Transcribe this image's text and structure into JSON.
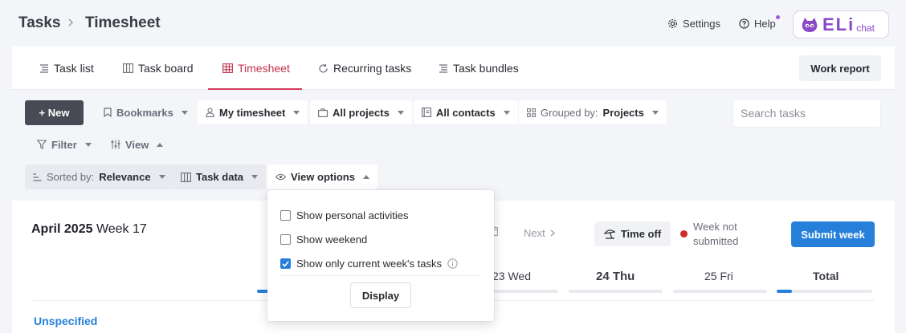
{
  "breadcrumb": {
    "parent": "Tasks",
    "current": "Timesheet"
  },
  "top_links": {
    "settings": "Settings",
    "help": "Help"
  },
  "eli": {
    "logo": "ELi",
    "sub": "chat"
  },
  "tabs": [
    {
      "label": "Task list",
      "icon": "list-icon"
    },
    {
      "label": "Task board",
      "icon": "board-icon"
    },
    {
      "label": "Timesheet",
      "icon": "grid-icon",
      "active": true
    },
    {
      "label": "Recurring tasks",
      "icon": "refresh-icon"
    },
    {
      "label": "Task bundles",
      "icon": "list-icon"
    }
  ],
  "work_report": "Work report",
  "toolbar": {
    "new": "+ New",
    "bookmarks": "Bookmarks",
    "my_timesheet": "My timesheet",
    "all_projects": "All projects",
    "all_contacts": "All contacts",
    "grouped_by_prefix": "Grouped by:",
    "grouped_by_value": "Projects",
    "search_placeholder": "Search tasks",
    "filter": "Filter",
    "view": "View",
    "sorted_prefix": "Sorted by:",
    "sorted_value": "Relevance",
    "task_data": "Task data",
    "view_options": "View options"
  },
  "view_options_menu": {
    "options": [
      {
        "label": "Show personal activities",
        "checked": false
      },
      {
        "label": "Show weekend",
        "checked": false
      },
      {
        "label": "Show only current week's tasks",
        "checked": true
      }
    ],
    "display": "Display"
  },
  "timesheet": {
    "month_year": "April 2025",
    "week": "Week 17",
    "next": "Next",
    "time_off": "Time off",
    "status": "Week not submitted",
    "submit": "Submit week",
    "days": [
      {
        "label": "23 Wed",
        "bold": false,
        "progress": 0
      },
      {
        "label": "24 Thu",
        "bold": true,
        "progress": 0
      },
      {
        "label": "25 Fri",
        "bold": false,
        "progress": 0
      },
      {
        "label": "Total",
        "bold": true,
        "progress": 0.16
      }
    ],
    "group": "Unspecified"
  },
  "colors": {
    "accent": "#2680d9",
    "active_tab": "#c2334d",
    "new_button": "#484a55",
    "status_dot": "#d22a2a",
    "eli": "#8b49c9"
  }
}
